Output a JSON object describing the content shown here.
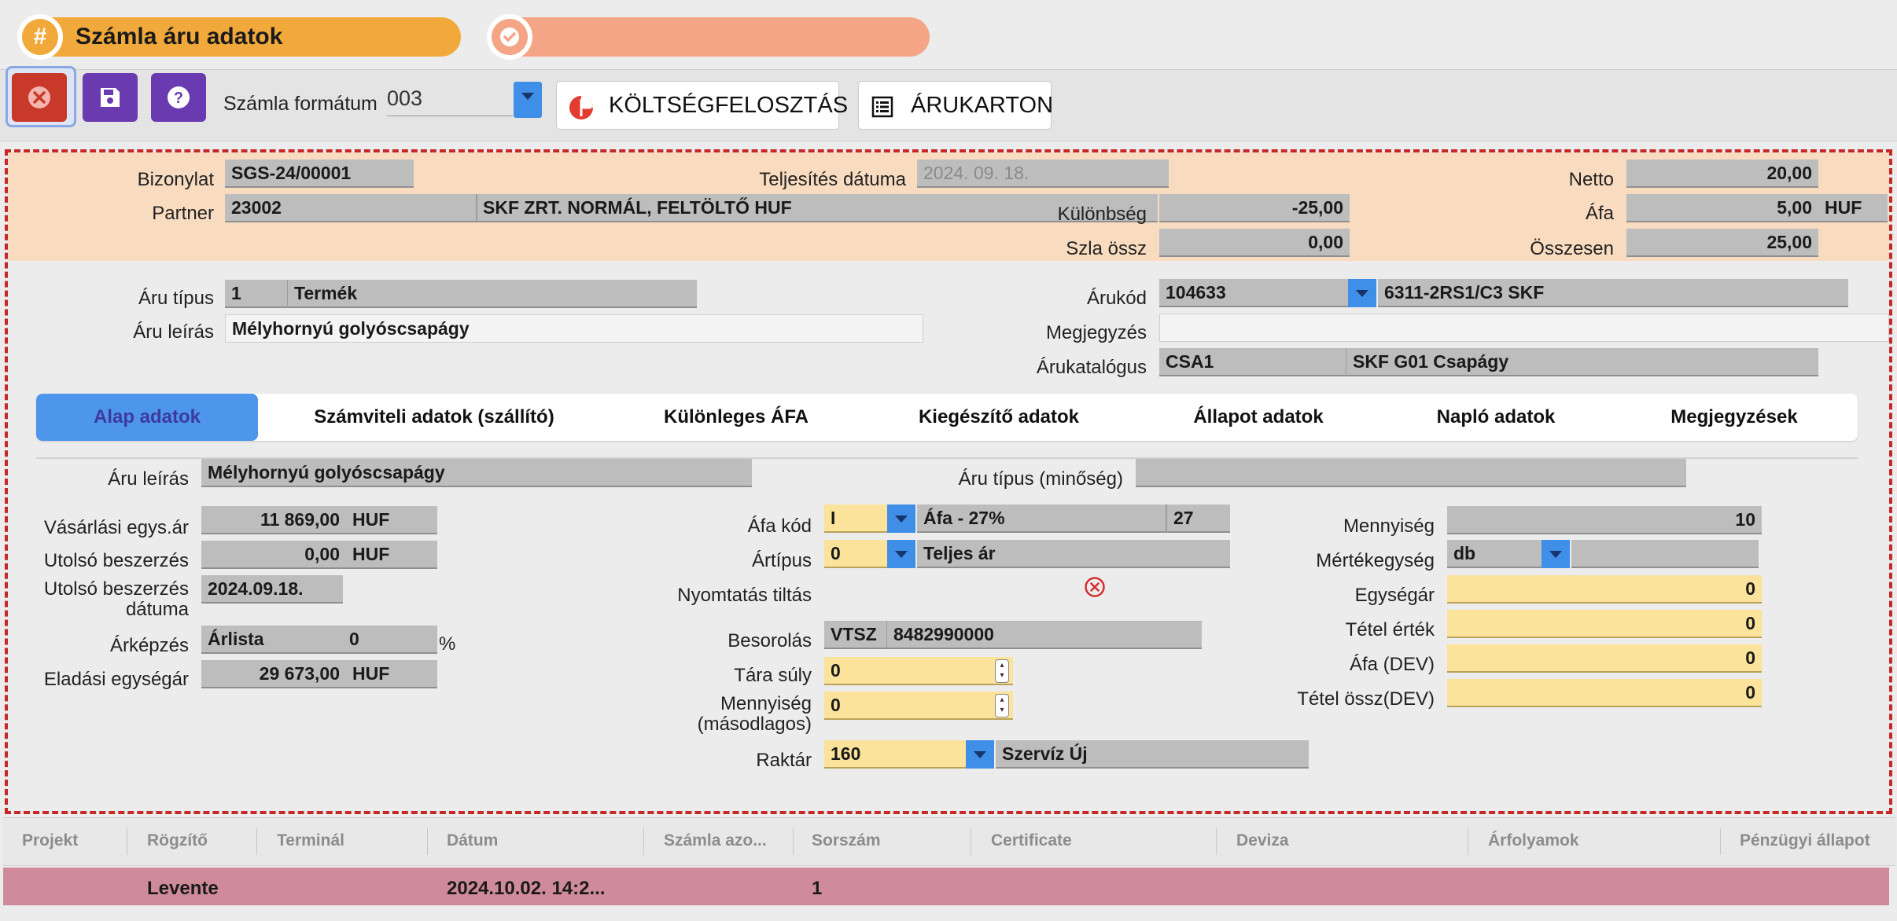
{
  "header": {
    "title": "Számla áru adatok",
    "title_icon": "hash-icon",
    "second_icon": "check-badge-icon",
    "accent_orange": "#f2a93b",
    "accent_salmon": "#f3a586"
  },
  "toolbar": {
    "format_label": "Számla formátum",
    "format_value": "003",
    "cost_button": "KÖLTSÉGFELOSZTÁS",
    "cost_icon": "pie-chart-icon",
    "card_button": "ÁRUKARTON",
    "card_icon": "list-icon",
    "close_icon": "close-icon",
    "save_icon": "save-icon",
    "help_icon": "help-icon"
  },
  "summary": {
    "bizonylat_label": "Bizonylat",
    "bizonylat_value": "SGS-24/00001",
    "partner_label": "Partner",
    "partner_code": "23002",
    "partner_name": "SKF ZRT. NORMÁL, FELTÖLTŐ HUF",
    "teljesites_label": "Teljesítés dátuma",
    "teljesites_value": "2024. 09. 18.",
    "kulonbseg_label": "Különbség",
    "kulonbseg_value": "-25,00",
    "szla_ossz_label": "Szla össz",
    "szla_ossz_value": "0,00",
    "netto_label": "Netto",
    "netto_value": "20,00",
    "afa_label": "Áfa",
    "afa_value": "5,00",
    "afa_currency": "HUF",
    "osszesen_label": "Összesen",
    "osszesen_value": "25,00"
  },
  "item": {
    "aru_tipus_label": "Áru típus",
    "aru_tipus_code": "1",
    "aru_tipus_name": "Termék",
    "aru_leiras_label": "Áru leírás",
    "aru_leiras_value": "Mélyhornyú golyóscsapágy",
    "arukod_label": "Árukód",
    "arukod_value": "104633",
    "arukod_name": "6311-2RS1/C3 SKF",
    "megjegyzes_label": "Megjegyzés",
    "megjegyzes_value": "",
    "arukatalogus_label": "Árukatalógus",
    "arukatalogus_code": "CSA1",
    "arukatalogus_name": "SKF G01 Csapágy"
  },
  "tabs": [
    {
      "label": "Alap adatok",
      "active": true
    },
    {
      "label": "Számviteli adatok (szállító)",
      "active": false
    },
    {
      "label": "Különleges ÁFA",
      "active": false
    },
    {
      "label": "Kiegészítő adatok",
      "active": false
    },
    {
      "label": "Állapot adatok",
      "active": false
    },
    {
      "label": "Napló adatok",
      "active": false
    },
    {
      "label": "Megjegyzések",
      "active": false
    }
  ],
  "details": {
    "aru_leiras_label": "Áru leírás",
    "aru_leiras_value": "Mélyhornyú golyóscsapágy",
    "aru_tipus_min_label": "Áru típus (minőség)",
    "aru_tipus_min_value": "",
    "vasarlasi_label": "Vásárlási egys.ár",
    "vasarlasi_value": "11 869,00",
    "vasarlasi_cur": "HUF",
    "utolso_besz_label": "Utolsó beszerzés",
    "utolso_besz_value": "0,00",
    "utolso_besz_cur": "HUF",
    "utolso_datum_label_1": "Utolsó beszerzés",
    "utolso_datum_label_2": "dátuma",
    "utolso_datum_value": "2024.09.18.",
    "arkepzes_label": "Árképzés",
    "arkepzes_value": "Árlista",
    "arkepzes_pct": "0",
    "arkepzes_pct_sign": "%",
    "eladasi_label": "Eladási egységár",
    "eladasi_value": "29 673,00",
    "eladasi_cur": "HUF",
    "afa_kod_label": "Áfa kód",
    "afa_kod_value": "I",
    "afa_kod_name": "Áfa - 27%",
    "afa_kod_rate": "27",
    "artipus_label": "Ártípus",
    "artipus_value": "0",
    "artipus_name": "Teljes ár",
    "nyomtatas_label": "Nyomtatás tiltás",
    "nyomtatas_icon": "close-circle-icon",
    "besorolas_label": "Besorolás",
    "besorolas_type": "VTSZ",
    "besorolas_value": "8482990000",
    "tara_label": "Tára súly",
    "tara_value": "0",
    "mennyiseg2_label_1": "Mennyiség",
    "mennyiseg2_label_2": "(másodlagos)",
    "mennyiseg2_value": "0",
    "raktar_label": "Raktár",
    "raktar_value": "160",
    "raktar_name": "Szervíz Új",
    "mennyiseg_label": "Mennyiség",
    "mennyiseg_value": "10",
    "mertekegyseg_label": "Mértékegység",
    "mertekegyseg_value": "db",
    "egysegar_label": "Egységár",
    "egysegar_value": "0",
    "tetel_ertek_label": "Tétel érték",
    "tetel_ertek_value": "0",
    "afa_dev_label": "Áfa (DEV)",
    "afa_dev_value": "0",
    "tetel_ossz_label": "Tétel össz(DEV)",
    "tetel_ossz_value": "0"
  },
  "table": {
    "columns": [
      "Projekt",
      "Rögzítő",
      "Terminál",
      "Dátum",
      "Számla azo...",
      "Sorszám",
      "Certificate",
      "Deviza",
      "Árfolyamok",
      "Pénzügyi állapot"
    ],
    "rows": [
      {
        "projekt": "",
        "rogzito": "Levente",
        "terminal": "",
        "datum": "2024.10.02. 14:2...",
        "szamla_azo": "",
        "sorszam": "1"
      }
    ],
    "row_color": "#cf8b9a"
  }
}
